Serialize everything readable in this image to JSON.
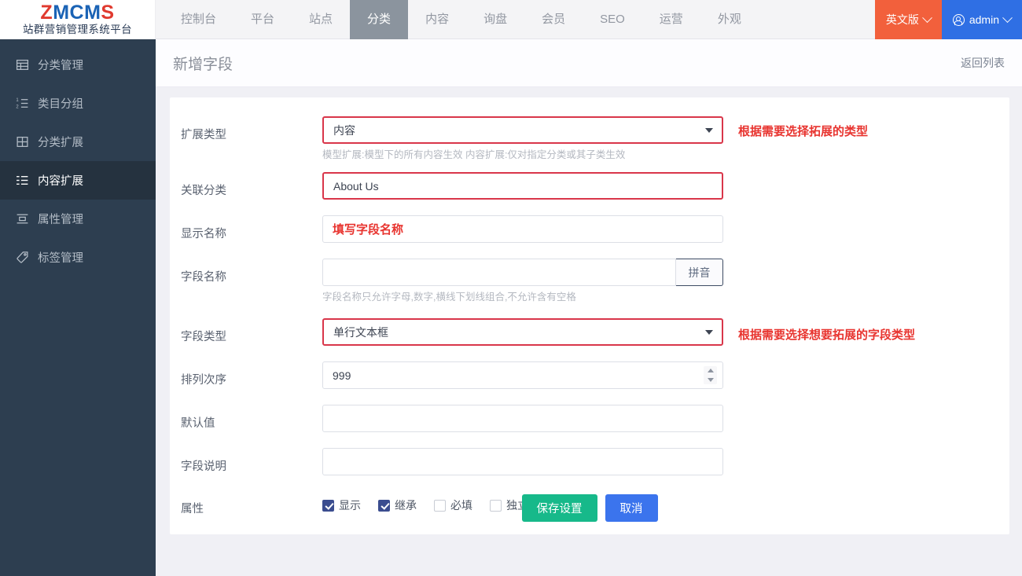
{
  "brand": {
    "logo_z": "Z",
    "logo_mcm": "MCM",
    "logo_s": "S",
    "subtitle": "站群营销管理系统平台",
    "red": "#e03a2f",
    "blue": "#1b63b5"
  },
  "topnav": {
    "items": [
      {
        "label": "控制台",
        "active": false
      },
      {
        "label": "平台",
        "active": false
      },
      {
        "label": "站点",
        "active": false
      },
      {
        "label": "分类",
        "active": true
      },
      {
        "label": "内容",
        "active": false
      },
      {
        "label": "询盘",
        "active": false
      },
      {
        "label": "会员",
        "active": false
      },
      {
        "label": "SEO",
        "active": false
      },
      {
        "label": "运营",
        "active": false
      },
      {
        "label": "外观",
        "active": false
      }
    ],
    "language_label": "英文版",
    "language_color": "#f2603c",
    "user_label": "admin",
    "user_color": "#2f6fe4"
  },
  "sidebar": {
    "items": [
      {
        "label": "分类管理",
        "icon": "table-icon",
        "active": false
      },
      {
        "label": "类目分组",
        "icon": "ordered-list-icon",
        "active": false
      },
      {
        "label": "分类扩展",
        "icon": "grid-icon",
        "active": false
      },
      {
        "label": "内容扩展",
        "icon": "list-settings-icon",
        "active": true
      },
      {
        "label": "属性管理",
        "icon": "layout-icon",
        "active": false
      },
      {
        "label": "标签管理",
        "icon": "tag-icon",
        "active": false
      }
    ]
  },
  "page": {
    "title": "新增字段",
    "back_link": "返回列表"
  },
  "form": {
    "ext_type": {
      "label": "扩展类型",
      "value": "内容",
      "hint": "模型扩展:模型下的所有内容生效 内容扩展:仅对指定分类或其子类生效",
      "annotation": "根据需要选择拓展的类型"
    },
    "related_category": {
      "label": "关联分类",
      "value": "About Us"
    },
    "display_name": {
      "label": "显示名称",
      "value": "",
      "placeholder": "填写字段名称"
    },
    "field_name": {
      "label": "字段名称",
      "value": "",
      "placeholder": "",
      "button": "拼音",
      "hint": "字段名称只允许字母,数字,横线下划线组合,不允许含有空格"
    },
    "field_type": {
      "label": "字段类型",
      "value": "单行文本框",
      "annotation": "根据需要选择想要拓展的字段类型"
    },
    "sort_order": {
      "label": "排列次序",
      "value": "999"
    },
    "default_value": {
      "label": "默认值",
      "value": "",
      "placeholder": ""
    },
    "field_desc": {
      "label": "字段说明",
      "value": "",
      "placeholder": ""
    },
    "attributes": {
      "label": "属性",
      "options": [
        {
          "label": "显示",
          "checked": true
        },
        {
          "label": "继承",
          "checked": true
        },
        {
          "label": "必填",
          "checked": false
        },
        {
          "label": "独立",
          "checked": false
        }
      ]
    },
    "actions": {
      "save": "保存设置",
      "cancel": "取消",
      "save_color": "#17b98a",
      "cancel_color": "#3b74ed"
    }
  }
}
